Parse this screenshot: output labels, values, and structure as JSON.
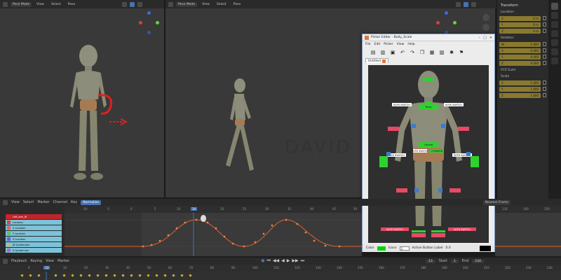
{
  "viewport_left": {
    "mode": "Pose Mode",
    "menu": [
      "View",
      "Select",
      "Pose"
    ]
  },
  "viewport_mid": {
    "mode": "Pose Mode",
    "menu": [
      "View",
      "Select",
      "Pose"
    ]
  },
  "watermark": "DAVID ONAN FUERTES MAS",
  "sidebar": {
    "title": "Transform",
    "location_label": "Location",
    "location": [
      [
        "X",
        "0 m"
      ],
      [
        "Y",
        "0 m"
      ],
      [
        "Z",
        "0 m"
      ]
    ],
    "rotation_label": "Rotation",
    "rotation": [
      [
        "W",
        "1.000"
      ],
      [
        "X",
        "0.000"
      ],
      [
        "Y",
        "0.000"
      ],
      [
        "Z",
        "0.000"
      ]
    ],
    "mode_label": "XYZ Euler",
    "scale_label": "Scale",
    "scale": [
      [
        "X",
        "1.000"
      ],
      [
        "Y",
        "1.000"
      ],
      [
        "Z",
        "1.000"
      ]
    ]
  },
  "picker": {
    "title": "Picker Editor - Body_Scale",
    "menu": [
      "File",
      "Edit",
      "Picker",
      "View",
      "Help"
    ],
    "tab": "Untitled",
    "buttons": {
      "torso": "Torso",
      "root": "Control",
      "ik_fk_left": "IK/FK SWITCH",
      "ik_fk_right": "IK/FK SWITCH",
      "center_label": "COMMON",
      "leg_left": "IK/FK SWITCH",
      "leg_right": "IK/FK SWITCH",
      "foot_left": "IK/FK SWITCH",
      "foot_right": "IK/FK SWITCH",
      "arm_l": "IK/FK SWITCH",
      "arm_r": "IK/FK SWITCH"
    },
    "bottom": {
      "color_label": "Color",
      "icons_label": "Icons",
      "icons_value": "2",
      "action_label": "Active Button Label",
      "action_value": "0.0"
    },
    "accent_green": "#2fd12f",
    "accent_red": "#e64a64",
    "accent_blue": "#3a7ad1"
  },
  "graph": {
    "menu": [
      "View",
      "Select",
      "Marker",
      "Channel",
      "Key",
      "Normalize"
    ],
    "right_label": "Nearest Frame",
    "channels": [
      "Left_arm_IK",
      "Location",
      "X Location",
      "Y Location",
      "Z Location",
      "W Quaternion",
      "X Quaternion",
      "Y Quaternion"
    ],
    "ruler": [
      "-10",
      "-5",
      "0",
      "5",
      "10",
      "15",
      "20",
      "25",
      "30",
      "35",
      "40",
      "45",
      "50"
    ],
    "current_frame": "14",
    "right_ruler": [
      "130",
      "140",
      "150"
    ],
    "curve_color": "#e06030"
  },
  "timeline": {
    "menu": [
      "Playback",
      "Keying",
      "View",
      "Marker"
    ],
    "current_frame": "13",
    "start_label": "Start",
    "start": "1",
    "end_label": "End",
    "end": "150",
    "ruler": [
      "0",
      "10",
      "20",
      "30",
      "40",
      "50",
      "60",
      "70",
      "80",
      "90",
      "100",
      "110",
      "120",
      "130",
      "140",
      "150",
      "160",
      "170",
      "180",
      "190",
      "200",
      "210",
      "220",
      "230",
      "240"
    ],
    "playhead": "13"
  }
}
